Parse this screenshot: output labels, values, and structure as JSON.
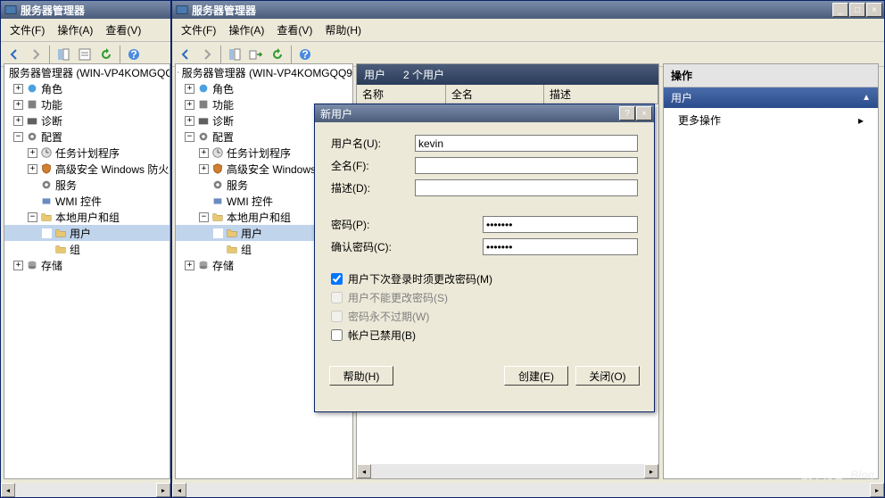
{
  "win1": {
    "title": "服务器管理器",
    "menus": [
      "文件(F)",
      "操作(A)",
      "查看(V)"
    ]
  },
  "win2": {
    "title": "服务器管理器",
    "menus": [
      "文件(F)",
      "操作(A)",
      "查看(V)",
      "帮助(H)"
    ]
  },
  "tree": {
    "root": "服务器管理器 (WIN-VP4KOMGQQ9",
    "root_short": "服务器管理器 (WIN-VP4KOMGQQ",
    "roles": "角色",
    "features": "功能",
    "diag": "诊断",
    "config": "配置",
    "task": "任务计划程序",
    "firewall": "高级安全 Windows 防火",
    "firewall2": "高级安全 Windows",
    "services": "服务",
    "wmi": "WMI 控件",
    "localug": "本地用户和组",
    "users": "用户",
    "groups": "组",
    "storage": "存储"
  },
  "middle": {
    "header": "用户",
    "count": "2 个用户",
    "cols": [
      "名称",
      "全名",
      "描述"
    ]
  },
  "actions": {
    "title": "操作",
    "user": "用户",
    "more": "更多操作"
  },
  "dialog": {
    "title": "新用户",
    "username_label": "用户名(U):",
    "username_value": "kevin",
    "fullname_label": "全名(F):",
    "desc_label": "描述(D):",
    "password_label": "密码(P):",
    "confirm_label": "确认密码(C):",
    "chk_mustchange": "用户下次登录时须更改密码(M)",
    "chk_cannotchange": "用户不能更改密码(S)",
    "chk_neverexpire": "密码永不过期(W)",
    "chk_disabled": "帐户已禁用(B)",
    "btn_help": "帮助(H)",
    "btn_create": "创建(E)",
    "btn_close": "关闭(O)"
  },
  "watermark": {
    "big": "51CTO.com",
    "small": "技术博客",
    "blog": "Blog"
  }
}
